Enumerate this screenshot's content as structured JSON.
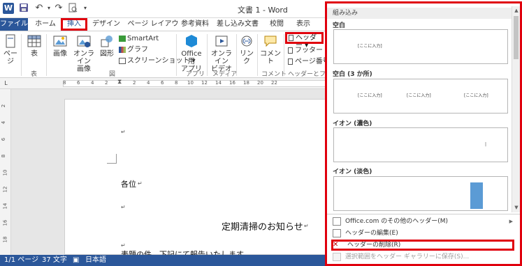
{
  "app": {
    "title": "文書 1 - Word",
    "logo_letter": "W"
  },
  "qat": {
    "save_icon": "save-icon",
    "undo_icon": "undo-icon",
    "redo_icon": "redo-icon",
    "preview_icon": "print-preview-icon",
    "customize_icon": "customize-icon"
  },
  "tabs": {
    "file": "ファイル",
    "home": "ホーム",
    "insert": "挿入",
    "design": "デザイン",
    "page_layout": "ページ レイアウト",
    "references": "参考資料",
    "mailings": "差し込み文書",
    "review": "校閲",
    "view": "表示"
  },
  "ribbon": {
    "page": "ページ",
    "table": "表",
    "table_group": "表",
    "picture": "画像",
    "online_picture_1": "オンライン",
    "online_picture_2": "画像",
    "shapes": "図形",
    "smartart": "SmartArt",
    "chart": "グラフ",
    "screenshot": "スクリーンショット",
    "figure_group": "図",
    "office_apps_1": "Office 用",
    "office_apps_2": "アプリ",
    "apps_group": "アプリ",
    "online_video_1": "オンライン",
    "online_video_2": "ビデオ",
    "media_group": "メディア",
    "link": "リンク",
    "comment": "コメント",
    "comment_group": "コメント",
    "header": "ヘッダー",
    "footer": "フッター",
    "page_number": "ページ番号",
    "header_footer_group": "ヘッダーとフッタ"
  },
  "ruler": {
    "numbers": [
      "8",
      "6",
      "4",
      "2",
      "2",
      "4",
      "6",
      "8",
      "10",
      "12",
      "14",
      "16",
      "18",
      "20",
      "22"
    ],
    "vertical": [
      "2",
      "4",
      "6",
      "8",
      "10",
      "12",
      "14",
      "16",
      "18"
    ]
  },
  "document": {
    "para_mark": "↵",
    "salutation": "各位",
    "heading": "定期清掃のお知らせ",
    "body_partial": "表題の件、下記にて報告いたします。"
  },
  "status": {
    "page": "1/1 ページ",
    "words": "37 文字",
    "language": "日本語"
  },
  "gallery": {
    "section_title": "組み込み",
    "items": [
      {
        "label": "空白",
        "placeholder": "[ここに入力]"
      },
      {
        "label": "空白 (3 か所)",
        "placeholder": "[ここに入力]"
      },
      {
        "label": "イオン (濃色)",
        "placeholder": ""
      },
      {
        "label": "イオン (淡色)",
        "placeholder": ""
      }
    ],
    "menu": {
      "more_headers": "Office.com のその他のヘッダー(M)",
      "edit_header": "ヘッダーの編集(E)",
      "remove_header": "ヘッダーの削除(R)",
      "save_selection": "選択範囲をヘッダー ギャラリーに保存(S)..."
    }
  },
  "colors": {
    "brand_blue": "#2b579a",
    "highlight_red": "#e0000d",
    "ion_accent": "#5b9bd5"
  }
}
